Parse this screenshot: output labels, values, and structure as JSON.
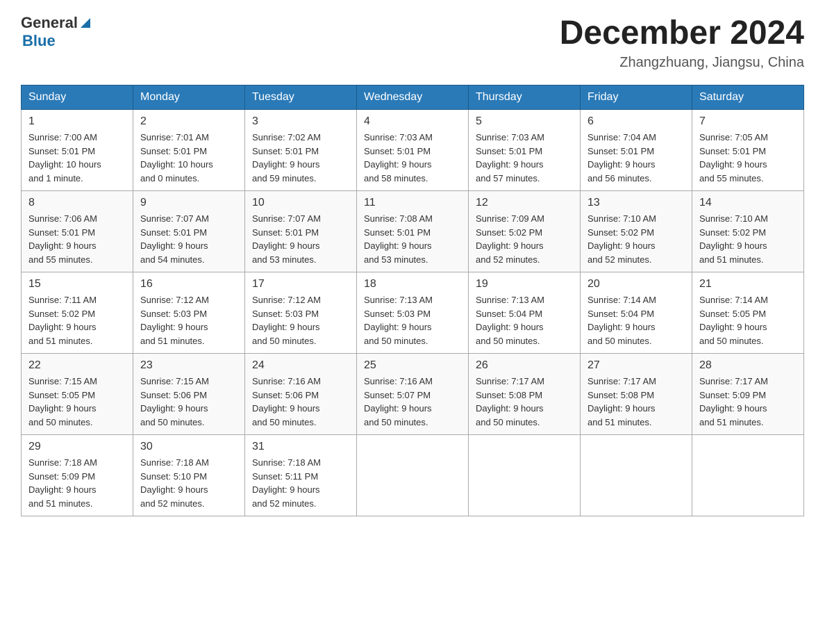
{
  "header": {
    "logo_general": "General",
    "logo_blue": "Blue",
    "month_title": "December 2024",
    "location": "Zhangzhuang, Jiangsu, China"
  },
  "days_of_week": [
    "Sunday",
    "Monday",
    "Tuesday",
    "Wednesday",
    "Thursday",
    "Friday",
    "Saturday"
  ],
  "weeks": [
    [
      {
        "day": "1",
        "info": "Sunrise: 7:00 AM\nSunset: 5:01 PM\nDaylight: 10 hours\nand 1 minute."
      },
      {
        "day": "2",
        "info": "Sunrise: 7:01 AM\nSunset: 5:01 PM\nDaylight: 10 hours\nand 0 minutes."
      },
      {
        "day": "3",
        "info": "Sunrise: 7:02 AM\nSunset: 5:01 PM\nDaylight: 9 hours\nand 59 minutes."
      },
      {
        "day": "4",
        "info": "Sunrise: 7:03 AM\nSunset: 5:01 PM\nDaylight: 9 hours\nand 58 minutes."
      },
      {
        "day": "5",
        "info": "Sunrise: 7:03 AM\nSunset: 5:01 PM\nDaylight: 9 hours\nand 57 minutes."
      },
      {
        "day": "6",
        "info": "Sunrise: 7:04 AM\nSunset: 5:01 PM\nDaylight: 9 hours\nand 56 minutes."
      },
      {
        "day": "7",
        "info": "Sunrise: 7:05 AM\nSunset: 5:01 PM\nDaylight: 9 hours\nand 55 minutes."
      }
    ],
    [
      {
        "day": "8",
        "info": "Sunrise: 7:06 AM\nSunset: 5:01 PM\nDaylight: 9 hours\nand 55 minutes."
      },
      {
        "day": "9",
        "info": "Sunrise: 7:07 AM\nSunset: 5:01 PM\nDaylight: 9 hours\nand 54 minutes."
      },
      {
        "day": "10",
        "info": "Sunrise: 7:07 AM\nSunset: 5:01 PM\nDaylight: 9 hours\nand 53 minutes."
      },
      {
        "day": "11",
        "info": "Sunrise: 7:08 AM\nSunset: 5:01 PM\nDaylight: 9 hours\nand 53 minutes."
      },
      {
        "day": "12",
        "info": "Sunrise: 7:09 AM\nSunset: 5:02 PM\nDaylight: 9 hours\nand 52 minutes."
      },
      {
        "day": "13",
        "info": "Sunrise: 7:10 AM\nSunset: 5:02 PM\nDaylight: 9 hours\nand 52 minutes."
      },
      {
        "day": "14",
        "info": "Sunrise: 7:10 AM\nSunset: 5:02 PM\nDaylight: 9 hours\nand 51 minutes."
      }
    ],
    [
      {
        "day": "15",
        "info": "Sunrise: 7:11 AM\nSunset: 5:02 PM\nDaylight: 9 hours\nand 51 minutes."
      },
      {
        "day": "16",
        "info": "Sunrise: 7:12 AM\nSunset: 5:03 PM\nDaylight: 9 hours\nand 51 minutes."
      },
      {
        "day": "17",
        "info": "Sunrise: 7:12 AM\nSunset: 5:03 PM\nDaylight: 9 hours\nand 50 minutes."
      },
      {
        "day": "18",
        "info": "Sunrise: 7:13 AM\nSunset: 5:03 PM\nDaylight: 9 hours\nand 50 minutes."
      },
      {
        "day": "19",
        "info": "Sunrise: 7:13 AM\nSunset: 5:04 PM\nDaylight: 9 hours\nand 50 minutes."
      },
      {
        "day": "20",
        "info": "Sunrise: 7:14 AM\nSunset: 5:04 PM\nDaylight: 9 hours\nand 50 minutes."
      },
      {
        "day": "21",
        "info": "Sunrise: 7:14 AM\nSunset: 5:05 PM\nDaylight: 9 hours\nand 50 minutes."
      }
    ],
    [
      {
        "day": "22",
        "info": "Sunrise: 7:15 AM\nSunset: 5:05 PM\nDaylight: 9 hours\nand 50 minutes."
      },
      {
        "day": "23",
        "info": "Sunrise: 7:15 AM\nSunset: 5:06 PM\nDaylight: 9 hours\nand 50 minutes."
      },
      {
        "day": "24",
        "info": "Sunrise: 7:16 AM\nSunset: 5:06 PM\nDaylight: 9 hours\nand 50 minutes."
      },
      {
        "day": "25",
        "info": "Sunrise: 7:16 AM\nSunset: 5:07 PM\nDaylight: 9 hours\nand 50 minutes."
      },
      {
        "day": "26",
        "info": "Sunrise: 7:17 AM\nSunset: 5:08 PM\nDaylight: 9 hours\nand 50 minutes."
      },
      {
        "day": "27",
        "info": "Sunrise: 7:17 AM\nSunset: 5:08 PM\nDaylight: 9 hours\nand 51 minutes."
      },
      {
        "day": "28",
        "info": "Sunrise: 7:17 AM\nSunset: 5:09 PM\nDaylight: 9 hours\nand 51 minutes."
      }
    ],
    [
      {
        "day": "29",
        "info": "Sunrise: 7:18 AM\nSunset: 5:09 PM\nDaylight: 9 hours\nand 51 minutes."
      },
      {
        "day": "30",
        "info": "Sunrise: 7:18 AM\nSunset: 5:10 PM\nDaylight: 9 hours\nand 52 minutes."
      },
      {
        "day": "31",
        "info": "Sunrise: 7:18 AM\nSunset: 5:11 PM\nDaylight: 9 hours\nand 52 minutes."
      },
      {
        "day": "",
        "info": ""
      },
      {
        "day": "",
        "info": ""
      },
      {
        "day": "",
        "info": ""
      },
      {
        "day": "",
        "info": ""
      }
    ]
  ]
}
